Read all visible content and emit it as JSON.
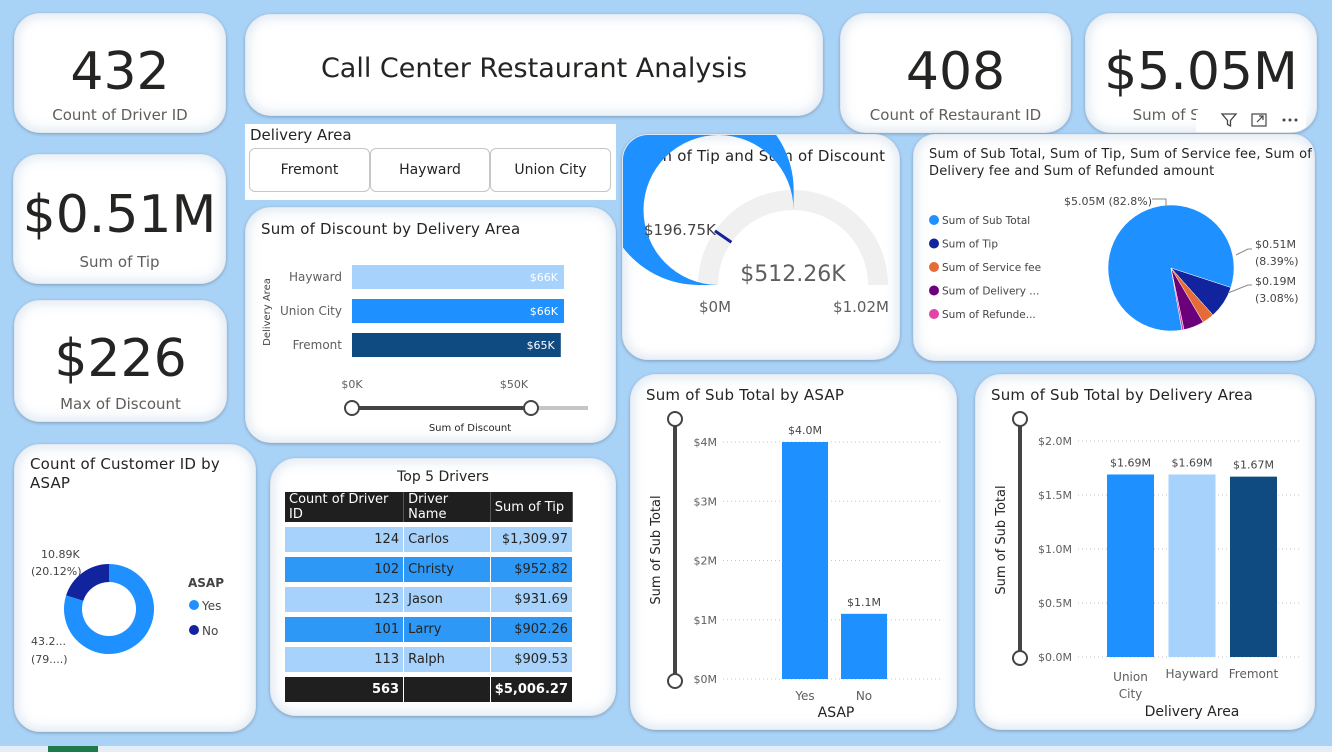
{
  "kpis": {
    "driver_count": {
      "value": "432",
      "label": "Count of Driver ID"
    },
    "restaurant_count": {
      "value": "408",
      "label": "Count of Restaurant ID"
    },
    "sum_subtotal": {
      "value": "$5.05M",
      "label": "Sum of Su"
    },
    "sum_tip": {
      "value": "$0.51M",
      "label": "Sum of Tip"
    },
    "max_discount": {
      "value": "$226",
      "label": "Max of Discount"
    }
  },
  "page_title": "Call Center Restaurant Analysis",
  "slicer": {
    "title": "Delivery Area",
    "options": [
      "Fremont",
      "Hayward",
      "Union City"
    ]
  },
  "icons": {
    "filter": "filter-icon",
    "focus": "focus-mode-icon",
    "more": "more-options-icon"
  },
  "colors": {
    "light_blue": "#a7d2fb",
    "mid_blue": "#1e90ff",
    "dark_blue": "#0f4a80",
    "navy": "#12239e",
    "orange": "#e66c37",
    "purple": "#6b007b",
    "pink": "#e044a7",
    "bg": "#a9d2f7"
  },
  "discount_by_area": {
    "title": "Sum of Discount by Delivery Area",
    "ylabel": "Delivery Area",
    "xlabel": "Sum of Discount",
    "ticks": [
      "$0K",
      "$50K"
    ]
  },
  "gauge": {
    "title": "Sum of Tip and Sum of Discount",
    "value_label": "$512.26K",
    "target_label": "$196.75K",
    "min_label": "$0M",
    "max_label": "$1.02M"
  },
  "pie": {
    "title_line1": "Sum of Sub Total, Sum of Tip, Sum of Service fee, Sum of",
    "title_line2": "Delivery fee and Sum of Refunded amount",
    "legend": [
      "Sum of Sub Total",
      "Sum of Tip",
      "Sum of Service fee",
      "Sum of Delivery ...",
      "Sum of Refunde..."
    ],
    "label_main": "$5.05M (82.8%)",
    "label_tip_1": "$0.51M",
    "label_tip_2": "(8.39%)",
    "label_fee_1": "$0.19M",
    "label_fee_2": "(3.08%)"
  },
  "donut": {
    "title_line1": "Count of Customer ID by",
    "title_line2": "ASAP",
    "legend_title": "ASAP",
    "legend": [
      "Yes",
      "No"
    ],
    "label_no_1": "10.89K",
    "label_no_2": "(20.12%)",
    "label_yes_1": "43.2...",
    "label_yes_2": "(79....)"
  },
  "drivers_table": {
    "title": "Top 5 Drivers",
    "headers": [
      "Count of Driver ID",
      "Driver Name",
      "Sum of Tip"
    ],
    "rows": [
      {
        "count": "124",
        "name": "Carlos",
        "tip": "$1,309.97"
      },
      {
        "count": "102",
        "name": "Christy",
        "tip": "$952.82"
      },
      {
        "count": "123",
        "name": "Jason",
        "tip": "$931.69"
      },
      {
        "count": "101",
        "name": "Larry",
        "tip": "$902.26"
      },
      {
        "count": "113",
        "name": "Ralph",
        "tip": "$909.53"
      }
    ],
    "total": {
      "count": "563",
      "name": "",
      "tip": "$5,006.27"
    }
  },
  "asap_chart": {
    "title": "Sum of Sub Total by ASAP",
    "ylabel": "Sum of Sub Total",
    "xlabel": "ASAP",
    "ticks": [
      "$0M",
      "$1M",
      "$2M",
      "$3M",
      "$4M"
    ]
  },
  "area_chart": {
    "title": "Sum of Sub Total by Delivery Area",
    "ylabel": "Sum of Sub Total",
    "xlabel": "Delivery Area",
    "ticks": [
      "$0.0M",
      "$0.5M",
      "$1.0M",
      "$1.5M",
      "$2.0M"
    ]
  },
  "chart_data": [
    {
      "type": "bar",
      "orientation": "horizontal",
      "title": "Sum of Discount by Delivery Area",
      "xlabel": "Sum of Discount",
      "ylabel": "Delivery Area",
      "categories": [
        "Hayward",
        "Union City",
        "Fremont"
      ],
      "values": [
        66,
        66,
        65
      ],
      "data_labels": [
        "$66K",
        "$66K",
        "$65K"
      ],
      "unit": "$K",
      "xlim": [
        0,
        66
      ]
    },
    {
      "type": "gauge",
      "title": "Sum of Tip and Sum of Discount",
      "value": 512.26,
      "target": 196.75,
      "min": 0,
      "max": 1020,
      "unit": "$K"
    },
    {
      "type": "pie",
      "title": "Sum of Sub Total, Sum of Tip, Sum of Service fee, Sum of Delivery fee and Sum of Refunded amount",
      "categories": [
        "Sum of Sub Total",
        "Sum of Tip",
        "Sum of Service fee",
        "Sum of Delivery fee",
        "Sum of Refunded amount"
      ],
      "percents": [
        82.8,
        8.39,
        3.08,
        5.2,
        0.53
      ],
      "legend": "left"
    },
    {
      "type": "pie",
      "variant": "donut",
      "title": "Count of Customer ID by ASAP",
      "categories": [
        "Yes",
        "No"
      ],
      "values": [
        43.2,
        10.89
      ],
      "percents": [
        79.88,
        20.12
      ],
      "unit": "K",
      "legend": "right"
    },
    {
      "type": "bar",
      "title": "Sum of Sub Total by ASAP",
      "xlabel": "ASAP",
      "ylabel": "Sum of Sub Total",
      "categories": [
        "Yes",
        "No"
      ],
      "values": [
        4.0,
        1.1
      ],
      "data_labels": [
        "$4.0M",
        "$1.1M"
      ],
      "unit": "$M",
      "ylim": [
        0,
        4
      ]
    },
    {
      "type": "bar",
      "title": "Sum of Sub Total by Delivery Area",
      "xlabel": "Delivery Area",
      "ylabel": "Sum of Sub Total",
      "categories": [
        "Union City",
        "Hayward",
        "Fremont"
      ],
      "values": [
        1.69,
        1.69,
        1.67
      ],
      "data_labels": [
        "$1.69M",
        "$1.69M",
        "$1.67M"
      ],
      "unit": "$M",
      "ylim": [
        0,
        2.0
      ]
    }
  ]
}
